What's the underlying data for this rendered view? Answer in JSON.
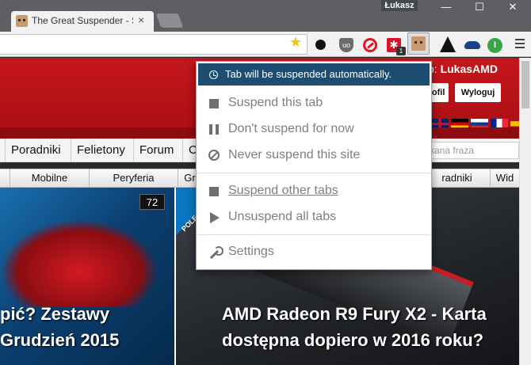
{
  "browser": {
    "profile_name": "Łukasz",
    "tab_title": "The Great Suspender - Se",
    "window_controls": [
      "—",
      "☐",
      "✕"
    ],
    "extensions": [
      {
        "icon": "black-dot-icon"
      },
      {
        "icon": "shield-icon",
        "text": "uo"
      },
      {
        "icon": "red-circle-icon"
      },
      {
        "icon": "puzzle-icon",
        "text": "✱",
        "badge": "1"
      },
      {
        "icon": "great-suspender-icon"
      },
      {
        "icon": "cat-icon"
      },
      {
        "icon": "cloud-icon"
      },
      {
        "icon": "green-circle-icon",
        "text": "I"
      }
    ]
  },
  "site": {
    "greeting_prefix": "o: ",
    "username": "LukasAMD",
    "profile_button": "rofil",
    "logout_button": "Wyloguj",
    "search_placeholder": "kana fraza",
    "nav": [
      "Poradniki",
      "Felietony",
      "Forum",
      "C"
    ],
    "categories": [
      "Mobilne",
      "Peryferia",
      "Gr",
      "radniki",
      "Wid"
    ],
    "cards": [
      {
        "title_line1": "pić? Zestawy",
        "title_line2": "Grudzień 2015",
        "comments": "72"
      },
      {
        "badge": "POLE",
        "title_line1": "AMD Radeon R9 Fury X2 - Karta",
        "title_line2": "dostępna dopiero w 2016 roku?"
      }
    ]
  },
  "popup": {
    "status": "Tab will be suspended automatically.",
    "items": [
      {
        "label": "Suspend this tab",
        "icon": "square-icon"
      },
      {
        "label": "Don't suspend for now",
        "icon": "pause-icon"
      },
      {
        "label": "Never suspend this site",
        "icon": "ban-icon"
      },
      {
        "label": "Suspend other tabs",
        "icon": "square-icon"
      },
      {
        "label": "Unsuspend all tabs",
        "icon": "play-icon"
      },
      {
        "label": "Settings",
        "icon": "wrench-icon"
      }
    ],
    "colors": {
      "status_bg": "#1d4e72",
      "item_text": "#7f7f7f"
    }
  }
}
